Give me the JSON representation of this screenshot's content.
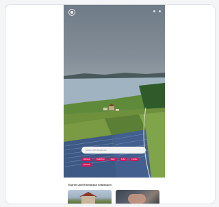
{
  "search": {
    "placeholder": "Suche nach Angeboten"
  },
  "chips": [
    "Wandern",
    "Radfahren",
    "Natur",
    "Kultur",
    "Familie",
    "Kulinarik"
  ],
  "section": {
    "title": "Touren und Erlebnisse entdecken"
  },
  "colors": {
    "accent": "#d1185e",
    "card_border": "#dfe3ea",
    "background": "#f4f5f7"
  },
  "icons": {
    "logo": "logo-icon",
    "menu": "menu-icon"
  }
}
